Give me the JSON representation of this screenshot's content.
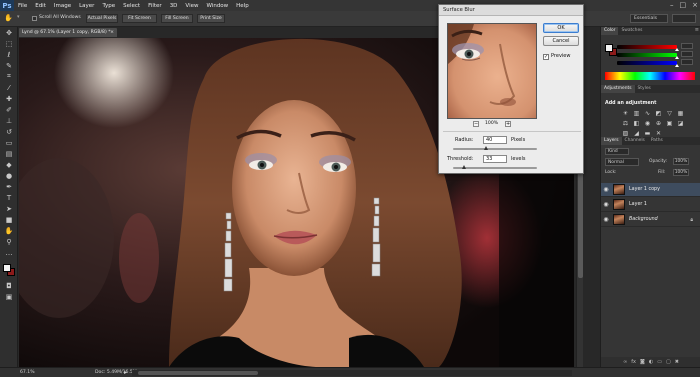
{
  "app": {
    "logo": "Ps",
    "menu": [
      "File",
      "Edit",
      "Image",
      "Layer",
      "Type",
      "Select",
      "Filter",
      "3D",
      "View",
      "Window",
      "Help"
    ],
    "window_controls": [
      "–",
      "□",
      "×"
    ]
  },
  "options_bar": {
    "scroll_all_windows": "Scroll All Windows",
    "actual_pixels": "Actual Pixels",
    "fit_screen": "Fit Screen",
    "fill_screen": "Fill Screen",
    "print_size": "Print Size",
    "workspace": "Essentials"
  },
  "document": {
    "tab_title": "Lynd @ 67.1% (Layer 1 copy, RGB/8) *",
    "tab_close": "×"
  },
  "status_bar": {
    "zoom": "67.1%",
    "doc_size": "Doc: 5.49M/16.5M",
    "arrow": "▸"
  },
  "dialog": {
    "title": "Surface Blur",
    "ok": "OK",
    "cancel": "Cancel",
    "preview_label": "Preview",
    "preview_checked": "✓",
    "zoom_value": "100%",
    "zoom_out": "−",
    "zoom_in": "+",
    "radius_label": "Radius:",
    "radius_value": "40",
    "radius_unit": "Pixels",
    "threshold_label": "Threshold:",
    "threshold_value": "33",
    "threshold_unit": "levels"
  },
  "panels": {
    "color_tabs": [
      "Color",
      "Swatches"
    ],
    "adjust_tabs": [
      "Adjustments",
      "Styles"
    ],
    "add_adjustment": "Add an adjustment",
    "layer_tabs": [
      "Layers",
      "Channels",
      "Paths"
    ],
    "kind": "Kind",
    "blend_mode": "Normal",
    "opacity_label": "Opacity:",
    "opacity_value": "100%",
    "lock_label": "Lock:",
    "fill_label": "Fill:",
    "fill_value": "100%",
    "layers": [
      {
        "name": "Layer 1 copy",
        "selected": true
      },
      {
        "name": "Layer 1",
        "selected": false
      },
      {
        "name": "Background",
        "selected": false
      }
    ]
  },
  "colors": {
    "foreground": "#f2f2f2",
    "background": "#8b1a1a"
  }
}
